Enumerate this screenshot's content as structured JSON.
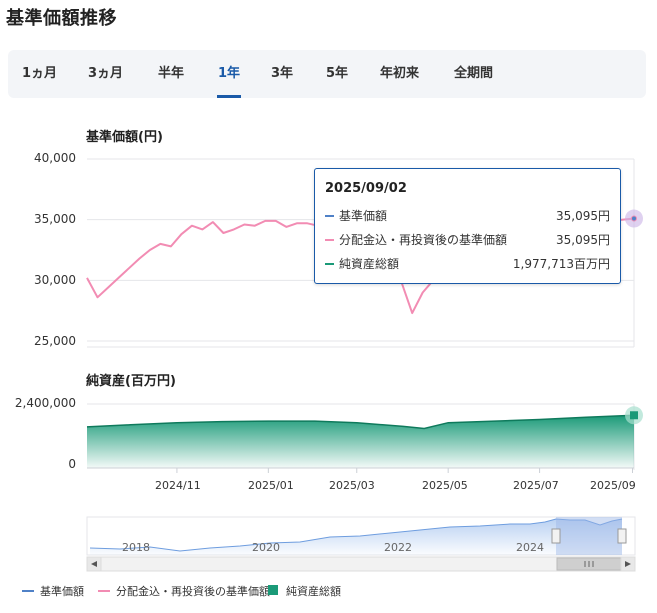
{
  "page": {
    "title": "基準価額推移"
  },
  "tabs": [
    {
      "label": "1ヵ月",
      "active": false
    },
    {
      "label": "3ヵ月",
      "active": false
    },
    {
      "label": "半年",
      "active": false
    },
    {
      "label": "1年",
      "active": true
    },
    {
      "label": "3年",
      "active": false
    },
    {
      "label": "5年",
      "active": false
    },
    {
      "label": "年初来",
      "active": false
    },
    {
      "label": "全期間",
      "active": false
    }
  ],
  "colors": {
    "price": "#4f81c7",
    "reinvested": "#f28cb3",
    "assets": "#1a9a78",
    "tab_active": "#1a5aa8"
  },
  "tooltip": {
    "date": "2025/09/02",
    "rows": [
      {
        "name": "基準価額",
        "value": "35,095円"
      },
      {
        "name": "分配金込・再投資後の基準価額",
        "value": "35,095円"
      },
      {
        "name": "純資産総額",
        "value": "1,977,713百万円"
      }
    ]
  },
  "legend": [
    {
      "label": "基準価額"
    },
    {
      "label": "分配金込・再投資後の基準価額"
    },
    {
      "label": "純資産総額"
    }
  ],
  "navigator": {
    "years": [
      "2018",
      "2020",
      "2022",
      "2024"
    ]
  },
  "chart_data": [
    {
      "type": "line",
      "title": "基準価額(円)",
      "ylim": [
        25000,
        40000
      ],
      "yticks": [
        "40,000",
        "35,000",
        "30,000",
        "25,000"
      ],
      "grid": true,
      "series": [
        {
          "name": "分配金込・再投資後の基準価額",
          "x": [
            "2024/09/02",
            "2024/09/09",
            "2024/09/16",
            "2024/09/23",
            "2024/09/30",
            "2024/10/07",
            "2024/10/14",
            "2024/10/21",
            "2024/10/28",
            "2024/11/04",
            "2024/11/11",
            "2024/11/18",
            "2024/11/25",
            "2024/12/02",
            "2024/12/09",
            "2024/12/16",
            "2024/12/23",
            "2024/12/30",
            "2025/01/06",
            "2025/01/13",
            "2025/01/20",
            "2025/01/27",
            "2025/02/03",
            "2025/02/10",
            "2025/02/17",
            "2025/02/24",
            "2025/03/03",
            "2025/03/10",
            "2025/03/17",
            "2025/03/24",
            "2025/03/31",
            "2025/04/07",
            "2025/04/14",
            "2025/04/21",
            "2025/04/28",
            "2025/05/05",
            "2025/05/12",
            "2025/05/19",
            "2025/05/26",
            "2025/06/02",
            "2025/06/09",
            "2025/06/16",
            "2025/06/23",
            "2025/06/30",
            "2025/07/07",
            "2025/07/14",
            "2025/07/21",
            "2025/07/28",
            "2025/08/04",
            "2025/08/11",
            "2025/08/18",
            "2025/08/25",
            "2025/09/02"
          ],
          "values": [
            30200,
            28600,
            29400,
            30200,
            31000,
            31800,
            32500,
            33000,
            32800,
            33800,
            34500,
            34200,
            34800,
            33900,
            34200,
            34600,
            34500,
            34900,
            34900,
            34400,
            34700,
            34700,
            34500,
            34600,
            34800,
            34300,
            33900,
            33000,
            32500,
            31600,
            29800,
            27300,
            29000,
            30000,
            31500,
            32500,
            33000,
            33200,
            33300,
            33500,
            33800,
            33600,
            33900,
            34100,
            34300,
            34300,
            34500,
            34700,
            34800,
            34900,
            34900,
            35000,
            35095
          ]
        },
        {
          "name": "基準価額",
          "x": [
            "2025/09/02"
          ],
          "values": [
            35095
          ]
        }
      ]
    },
    {
      "type": "area",
      "title": "純資産(百万円)",
      "ylim": [
        0,
        2400000
      ],
      "yticks": [
        "2,400,000",
        "0"
      ],
      "xticks": [
        "2024/11",
        "2025/01",
        "2025/03",
        "2025/05",
        "2025/07",
        "2025/09"
      ],
      "series": [
        {
          "name": "純資産総額",
          "x": [
            "2024/09/02",
            "2024/10/01",
            "2024/11/01",
            "2024/12/01",
            "2025/01/01",
            "2025/02/01",
            "2025/03/01",
            "2025/04/01",
            "2025/04/15",
            "2025/05/01",
            "2025/06/01",
            "2025/07/01",
            "2025/08/01",
            "2025/09/02"
          ],
          "values": [
            1540000,
            1620000,
            1700000,
            1740000,
            1760000,
            1760000,
            1700000,
            1560000,
            1480000,
            1700000,
            1760000,
            1820000,
            1900000,
            1977713
          ]
        }
      ]
    }
  ]
}
